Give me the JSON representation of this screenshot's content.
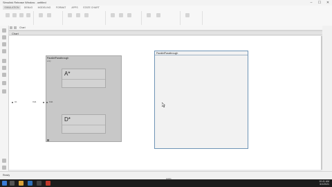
{
  "window": {
    "title": "Simulink Release Window - untitled",
    "minimize_glyph": "–",
    "maximize_glyph": "☐",
    "close_glyph": "✕"
  },
  "ribbon": {
    "tabs": [
      "SIMULATION",
      "DEBUG",
      "MODELING",
      "FORMAT",
      "APPS",
      "STATE CHART"
    ]
  },
  "nav": {
    "breadcrumb": "Chart"
  },
  "document": {
    "tab_label": "Chart"
  },
  "diagram": {
    "state1": {
      "label": "ParallelPassthrough",
      "sub": "entry:",
      "substate_a": "A*",
      "substate_b": "D*"
    },
    "state2": {
      "label": "ParallelPassthrough"
    },
    "port_in_label": "In1",
    "port_mid_label": "Out1",
    "port_out_label": "Out1"
  },
  "statusbar": {
    "left": "Ready",
    "center": "100%"
  },
  "taskbar": {
    "time": "10:41 AM",
    "date": "6/1/2021"
  },
  "colors": {
    "state_fill": "#c8c8c8",
    "selected_border": "#6e93b5",
    "taskbar": "#1c1c1c"
  }
}
